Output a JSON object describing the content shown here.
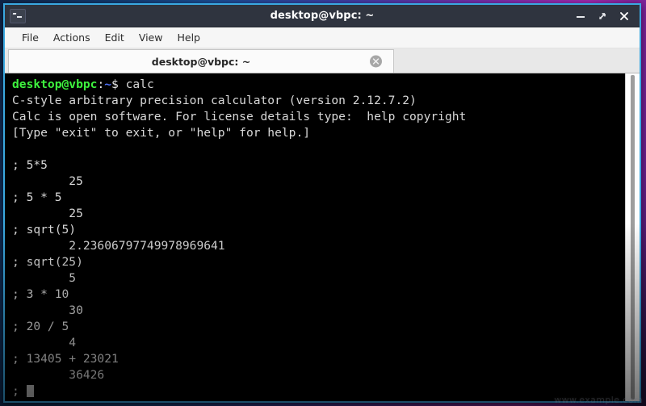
{
  "window": {
    "title": "desktop@vbpc: ~",
    "icon": "terminal-icon",
    "buttons": {
      "minimize": "−",
      "maximize": "⤡",
      "close": "×"
    }
  },
  "menubar": {
    "items": [
      {
        "label": "File"
      },
      {
        "label": "Actions"
      },
      {
        "label": "Edit"
      },
      {
        "label": "View"
      },
      {
        "label": "Help"
      }
    ]
  },
  "tabbar": {
    "tabs": [
      {
        "label": "desktop@vbpc: ~",
        "close_icon": "close-circle-icon"
      }
    ]
  },
  "terminal": {
    "colors": {
      "background": "#000000",
      "foreground": "#d8d8d8",
      "prompt_user": "#3ef23e",
      "prompt_path": "#4d6ff5",
      "cursor": "#b8b8b8"
    },
    "prompt": {
      "user_host": "desktop@vbpc",
      "colon": ":",
      "path": "~",
      "dollar": "$",
      "command": " calc"
    },
    "lines": [
      {
        "type": "prompt",
        "command": "calc"
      },
      {
        "type": "text",
        "text": "C-style arbitrary precision calculator (version 2.12.7.2)"
      },
      {
        "type": "text",
        "text": "Calc is open software. For license details type:  help copyright"
      },
      {
        "type": "text",
        "text": "[Type \"exit\" to exit, or \"help\" for help.]"
      },
      {
        "type": "text",
        "text": ""
      },
      {
        "type": "text",
        "text": "; 5*5"
      },
      {
        "type": "text",
        "text": "        25"
      },
      {
        "type": "text",
        "text": "; 5 * 5"
      },
      {
        "type": "text",
        "text": "        25"
      },
      {
        "type": "text",
        "text": "; sqrt(5)"
      },
      {
        "type": "text",
        "text": "        2.23606797749978969641"
      },
      {
        "type": "text",
        "text": "; sqrt(25)"
      },
      {
        "type": "text",
        "text": "        5"
      },
      {
        "type": "text",
        "text": "; 3 * 10"
      },
      {
        "type": "text",
        "text": "        30"
      },
      {
        "type": "text",
        "text": "; 20 / 5"
      },
      {
        "type": "text",
        "text": "        4"
      },
      {
        "type": "text",
        "text": "; 13405 + 23021"
      },
      {
        "type": "text",
        "text": "        36426"
      },
      {
        "type": "cursor",
        "text": "; "
      }
    ],
    "scrollbar": {
      "position": "right"
    }
  },
  "watermark": {
    "text": "www.example.com"
  }
}
